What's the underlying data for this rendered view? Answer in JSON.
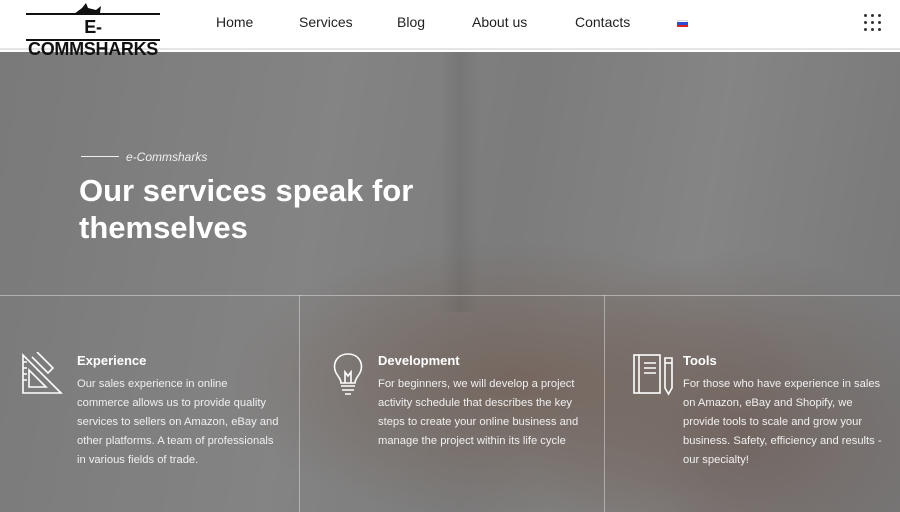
{
  "header": {
    "logo_text": "E-COMMSHARKS",
    "nav": [
      "Home",
      "Services",
      "Blog",
      "About us",
      "Contacts"
    ],
    "language_flag": "russian-flag-icon",
    "menu_icon": "grid-dots-icon"
  },
  "hero": {
    "eyebrow": "e-Commsharks",
    "title": "Our services speak for themselves"
  },
  "features": [
    {
      "icon": "ruler-triangle-icon",
      "title": "Experience",
      "text": "Our sales experience in online commerce allows us to provide quality services to sellers on Amazon, eBay and other platforms. A team of professionals in various fields of trade."
    },
    {
      "icon": "lightbulb-icon",
      "title": "Development",
      "text": "For beginners, we will develop a project activity schedule that describes the key steps to create your online business and manage the project within its life cycle"
    },
    {
      "icon": "notebook-pencil-icon",
      "title": "Tools",
      "text": "For those who have experience in sales on Amazon, eBay and Shopify, we provide tools to scale and grow your business. Safety, efficiency and results - our specialty!"
    }
  ],
  "colors": {
    "header_bg": "#ffffff",
    "overlay": "#282828",
    "text_light": "#ffffff"
  }
}
